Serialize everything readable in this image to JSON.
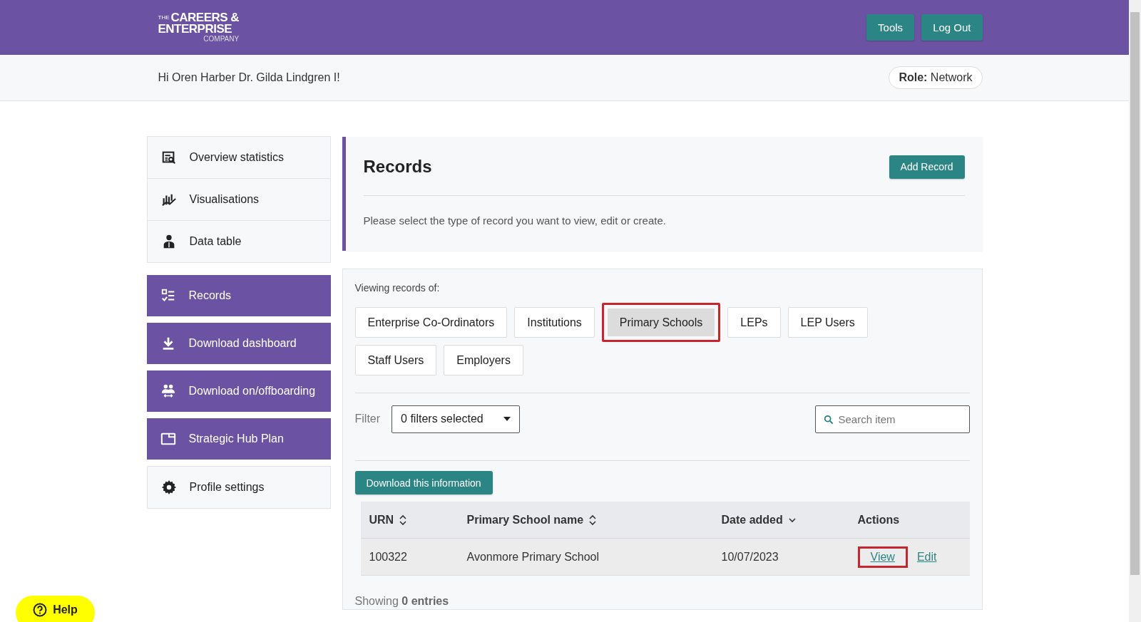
{
  "header": {
    "logo": {
      "small": "THE",
      "line_1": "CAREERS &",
      "line_2": "ENTERPRISE",
      "line_3": "COMPANY"
    },
    "buttons": [
      "Tools",
      "Log Out"
    ]
  },
  "greeting": "Hi Oren Harber Dr. Gilda Lindgren I!",
  "role": {
    "label": "Role:",
    "value": "Network"
  },
  "sidebar": {
    "items": [
      {
        "label": "Overview statistics",
        "kind": "light"
      },
      {
        "label": "Visualisations",
        "kind": "light"
      },
      {
        "label": "Data table",
        "kind": "light"
      },
      {
        "label": "Records",
        "kind": "dark"
      },
      {
        "label": "Download dashboard",
        "kind": "dark"
      },
      {
        "label": "Download on/offboarding",
        "kind": "dark"
      },
      {
        "label": "Strategic Hub Plan",
        "kind": "dark"
      },
      {
        "label": "Profile settings",
        "kind": "light"
      }
    ]
  },
  "records_card": {
    "title": "Records",
    "button": "Add Record",
    "description": "Please select the type of record you want to view, edit or create."
  },
  "viewer": {
    "caption": "Viewing records of:",
    "tabs": [
      {
        "label": "Enterprise Co-Ordinators",
        "selected": false,
        "highlighted": false
      },
      {
        "label": "Institutions",
        "selected": false,
        "highlighted": false
      },
      {
        "label": "Primary Schools",
        "selected": true,
        "highlighted": true
      },
      {
        "label": "LEPs",
        "selected": false,
        "highlighted": false
      },
      {
        "label": "LEP Users",
        "selected": false,
        "highlighted": false
      },
      {
        "label": "Staff Users",
        "selected": false,
        "highlighted": false
      },
      {
        "label": "Employers",
        "selected": false,
        "highlighted": false
      }
    ],
    "filter": {
      "label": "Filter",
      "value": "0 filters selected"
    },
    "search": {
      "placeholder": "Search item"
    },
    "download_button": "Download this information",
    "table": {
      "columns": [
        {
          "label": "URN",
          "kind": "sortable"
        },
        {
          "label": "Primary School name",
          "kind": "sortable"
        },
        {
          "label": "Date added",
          "kind": "sorted"
        },
        {
          "label": "Actions",
          "kind": "plain"
        }
      ],
      "rows": [
        {
          "urn": "100322",
          "name": "Avonmore Primary School",
          "date": "10/07/2023",
          "actions": [
            {
              "label": "View",
              "highlighted": true
            },
            {
              "label": "Edit",
              "highlighted": false
            }
          ]
        }
      ]
    },
    "footer": {
      "prefix": "Showing",
      "count": "0 entries"
    }
  },
  "help": "Help"
}
